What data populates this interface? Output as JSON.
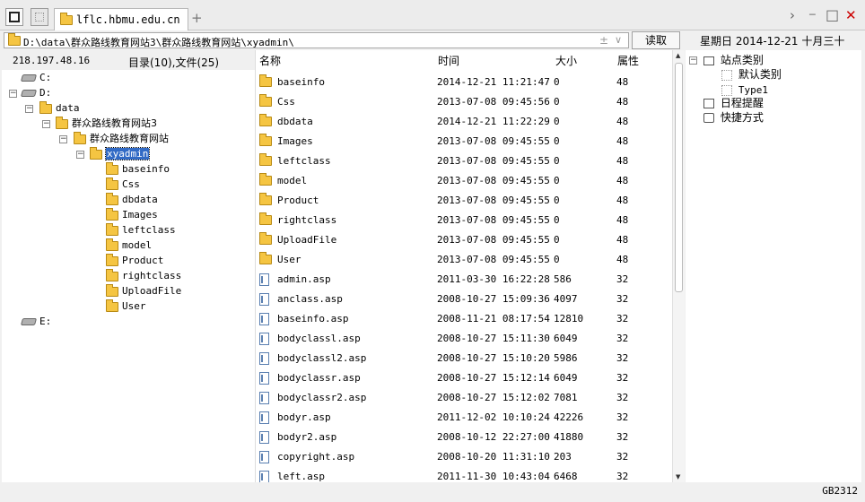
{
  "tab": {
    "title": "lflc.hbmu.edu.cn",
    "new_tab": "+"
  },
  "address": {
    "path": "D:\\data\\群众路线教育网站3\\群众路线教育网站\\xyadmin\\",
    "toggle": "±",
    "dropdown": "∨",
    "read_label": "读取"
  },
  "date_display": "星期日 2014-12-21 十月三十",
  "ip": "218.197.48.16",
  "counts": "目录(10),文件(25)",
  "columns": {
    "name": "名称",
    "time": "时间",
    "size": "大小",
    "attr": "属性"
  },
  "tree": {
    "c": "C:",
    "d": "D:",
    "data": "data",
    "site3": "群众路线教育网站3",
    "site": "群众路线教育网站",
    "xyadmin": "xyadmin",
    "children": [
      "baseinfo",
      "Css",
      "dbdata",
      "Images",
      "leftclass",
      "model",
      "Product",
      "rightclass",
      "UploadFile",
      "User"
    ],
    "e": "E:"
  },
  "files": [
    {
      "name": "baseinfo",
      "time": "2014-12-21 11:21:47",
      "size": "0",
      "attr": "48",
      "type": "folder"
    },
    {
      "name": "Css",
      "time": "2013-07-08 09:45:56",
      "size": "0",
      "attr": "48",
      "type": "folder"
    },
    {
      "name": "dbdata",
      "time": "2014-12-21 11:22:29",
      "size": "0",
      "attr": "48",
      "type": "folder"
    },
    {
      "name": "Images",
      "time": "2013-07-08 09:45:55",
      "size": "0",
      "attr": "48",
      "type": "folder"
    },
    {
      "name": "leftclass",
      "time": "2013-07-08 09:45:55",
      "size": "0",
      "attr": "48",
      "type": "folder"
    },
    {
      "name": "model",
      "time": "2013-07-08 09:45:55",
      "size": "0",
      "attr": "48",
      "type": "folder"
    },
    {
      "name": "Product",
      "time": "2013-07-08 09:45:55",
      "size": "0",
      "attr": "48",
      "type": "folder"
    },
    {
      "name": "rightclass",
      "time": "2013-07-08 09:45:55",
      "size": "0",
      "attr": "48",
      "type": "folder"
    },
    {
      "name": "UploadFile",
      "time": "2013-07-08 09:45:55",
      "size": "0",
      "attr": "48",
      "type": "folder"
    },
    {
      "name": "User",
      "time": "2013-07-08 09:45:55",
      "size": "0",
      "attr": "48",
      "type": "folder"
    },
    {
      "name": "admin.asp",
      "time": "2011-03-30 16:22:28",
      "size": "586",
      "attr": "32",
      "type": "file"
    },
    {
      "name": "anclass.asp",
      "time": "2008-10-27 15:09:36",
      "size": "4097",
      "attr": "32",
      "type": "file"
    },
    {
      "name": "baseinfo.asp",
      "time": "2008-11-21 08:17:54",
      "size": "12810",
      "attr": "32",
      "type": "file"
    },
    {
      "name": "bodyclassl.asp",
      "time": "2008-10-27 15:11:30",
      "size": "6049",
      "attr": "32",
      "type": "file"
    },
    {
      "name": "bodyclassl2.asp",
      "time": "2008-10-27 15:10:20",
      "size": "5986",
      "attr": "32",
      "type": "file"
    },
    {
      "name": "bodyclassr.asp",
      "time": "2008-10-27 15:12:14",
      "size": "6049",
      "attr": "32",
      "type": "file"
    },
    {
      "name": "bodyclassr2.asp",
      "time": "2008-10-27 15:12:02",
      "size": "7081",
      "attr": "32",
      "type": "file"
    },
    {
      "name": "bodyr.asp",
      "time": "2011-12-02 10:10:24",
      "size": "42226",
      "attr": "32",
      "type": "file"
    },
    {
      "name": "bodyr2.asp",
      "time": "2008-10-12 22:27:00",
      "size": "41880",
      "attr": "32",
      "type": "file"
    },
    {
      "name": "copyright.asp",
      "time": "2008-10-20 11:31:10",
      "size": "203",
      "attr": "32",
      "type": "file"
    },
    {
      "name": "left.asp",
      "time": "2011-11-30 10:43:04",
      "size": "6468",
      "attr": "32",
      "type": "file"
    }
  ],
  "right": {
    "site_category": "站点类别",
    "default_category": "默认类别",
    "type1": "Type1",
    "schedule": "日程提醒",
    "shortcut": "快捷方式"
  },
  "status": {
    "encoding": "GB2312"
  },
  "window": {
    "chevron": "›",
    "minimize": "─",
    "maximize": "□",
    "close": "✕"
  },
  "colors": {
    "selection": "#316ac5",
    "close": "#cc0000",
    "folder": "#f5c542"
  }
}
